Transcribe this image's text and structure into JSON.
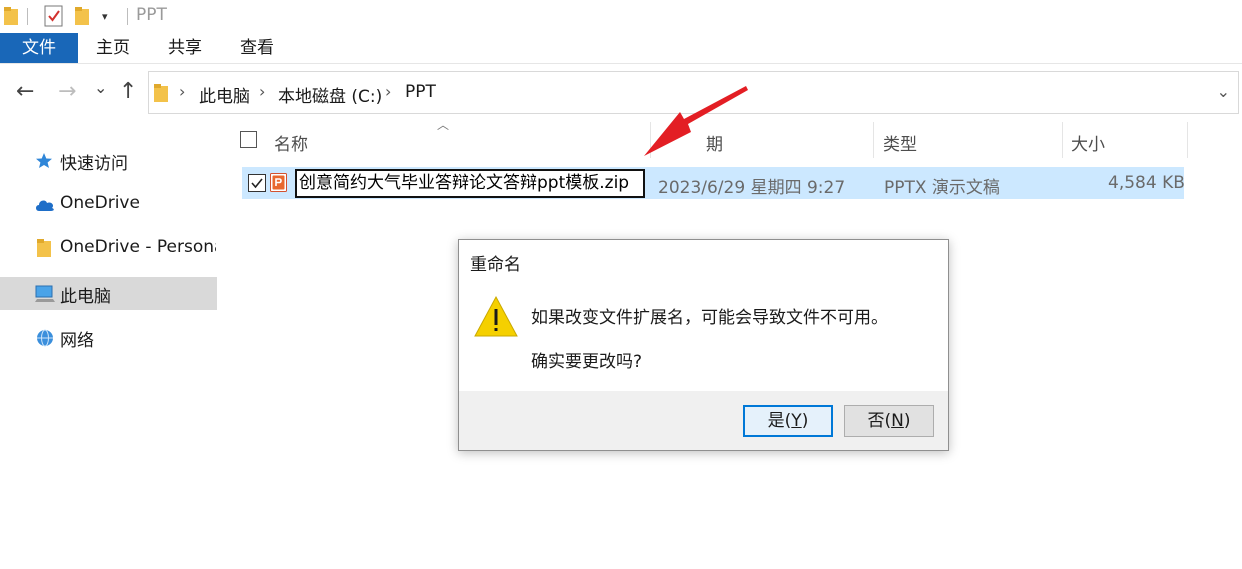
{
  "window": {
    "title": "PPT",
    "quick_access_dropdown": "▾"
  },
  "ribbon": {
    "tabs": [
      {
        "label": "文件",
        "active": true
      },
      {
        "label": "主页"
      },
      {
        "label": "共享"
      },
      {
        "label": "查看"
      }
    ]
  },
  "nav": {
    "back": "←",
    "forward": "→",
    "recent": "⌄",
    "up": "↑",
    "breadcrumb": [
      "此电脑",
      "本地磁盘 (C:)",
      "PPT"
    ],
    "separator": "›",
    "dropdown": "⌄"
  },
  "sidebar": {
    "items": [
      {
        "label": "快速访问",
        "icon": "star-icon"
      },
      {
        "label": "OneDrive",
        "icon": "cloud-icon"
      },
      {
        "label": "OneDrive - Personal",
        "icon": "folder-icon"
      },
      {
        "label": "此电脑",
        "icon": "computer-icon",
        "selected": true
      },
      {
        "label": "网络",
        "icon": "network-icon"
      }
    ]
  },
  "columns": {
    "name": "名称",
    "date": "期",
    "type": "类型",
    "size": "大小"
  },
  "file": {
    "name": "创意简约大气毕业答辩论文答辩ppt模板.zip",
    "modified": "2023/6/29 星期四 9:27",
    "type": "PPTX 演示文稿",
    "size": "4,584 KB",
    "checked": true
  },
  "dialog": {
    "title": "重命名",
    "message": "如果改变文件扩展名，可能会导致文件不可用。",
    "question": "确实要更改吗?",
    "yes_prefix": "是(",
    "yes_key": "Y",
    "yes_suffix": ")",
    "no_prefix": "否(",
    "no_key": "N",
    "no_suffix": ")"
  },
  "colors": {
    "accent": "#1967b8",
    "selection": "#cce8ff",
    "annotation_arrow": "#e31e24",
    "warning": "#f5d000"
  }
}
